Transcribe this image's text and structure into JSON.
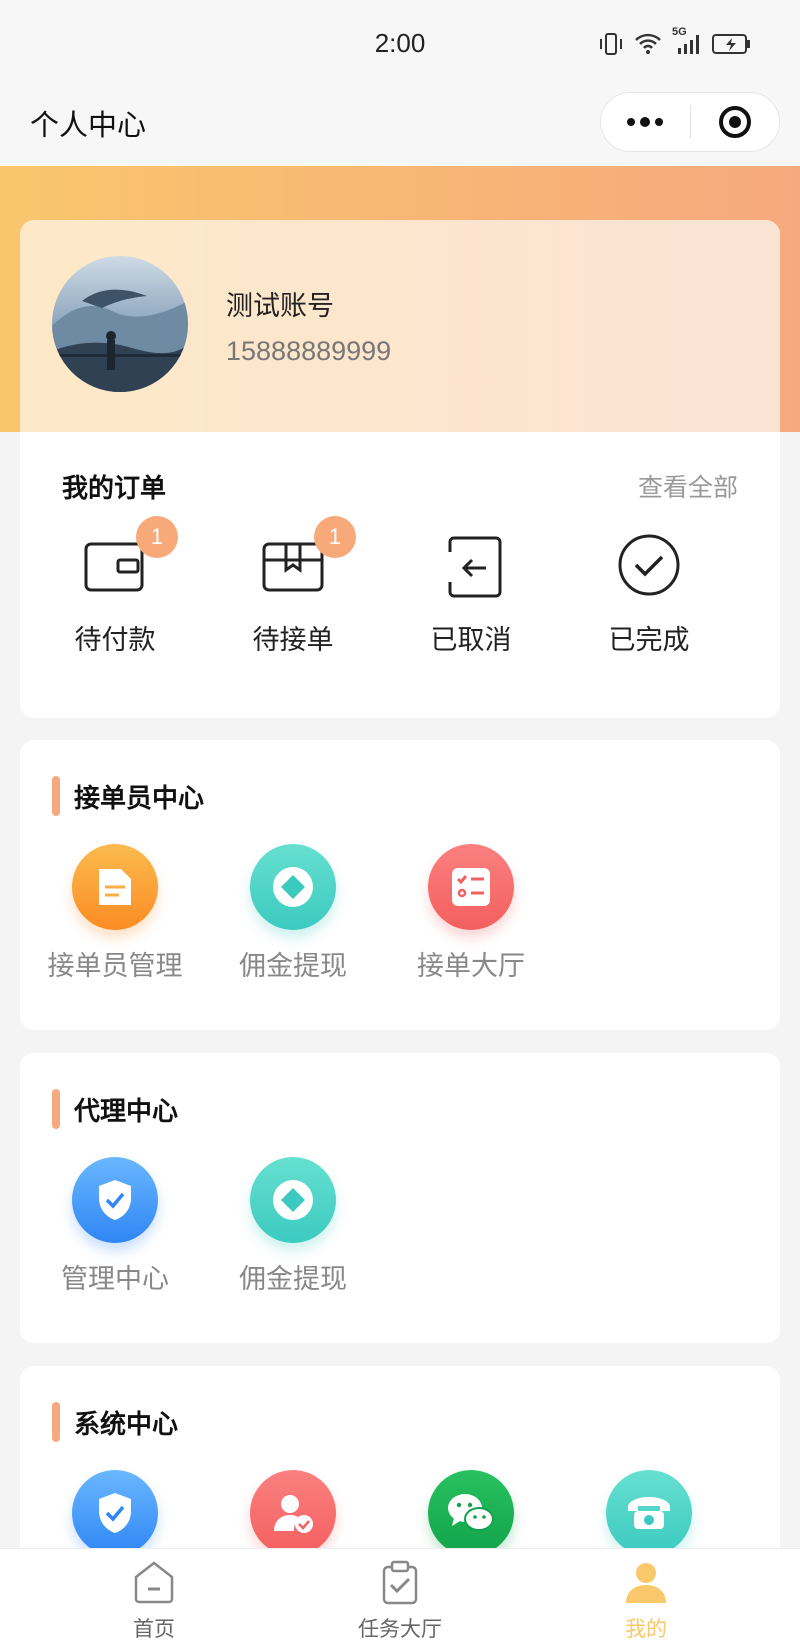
{
  "status_bar": {
    "time": "2:00",
    "network": "5G"
  },
  "navbar": {
    "title": "个人中心",
    "more_icon": "more-dots-icon",
    "target_icon": "target-icon"
  },
  "profile": {
    "name": "测试账号",
    "phone": "15888889999",
    "avatar": "avatar-photo"
  },
  "orders": {
    "title": "我的订单",
    "view_all": "查看全部",
    "items": [
      {
        "label": "待付款",
        "icon": "wallet-icon",
        "badge": "1"
      },
      {
        "label": "待接单",
        "icon": "package-icon",
        "badge": "1"
      },
      {
        "label": "已取消",
        "icon": "cancel-return-icon"
      },
      {
        "label": "已完成",
        "icon": "check-circle-icon"
      }
    ]
  },
  "picker_center": {
    "title": "接单员中心",
    "items": [
      {
        "label": "接单员管理",
        "icon": "document-icon",
        "color": "#fb8c23"
      },
      {
        "label": "佣金提现",
        "icon": "diamond-coin-icon",
        "color": "#3ccac0"
      },
      {
        "label": "接单大厅",
        "icon": "checklist-icon",
        "color": "#f45f5f"
      }
    ]
  },
  "agent_center": {
    "title": "代理中心",
    "items": [
      {
        "label": "管理中心",
        "icon": "shield-check-icon",
        "color": "#2f86f4"
      },
      {
        "label": "佣金提现",
        "icon": "diamond-coin-icon",
        "color": "#3ccac0"
      }
    ]
  },
  "system_center": {
    "title": "系统中心",
    "items": [
      {
        "icon": "shield-check-icon",
        "color": "#2f86f4"
      },
      {
        "icon": "user-verified-icon",
        "color": "#f45f5f"
      },
      {
        "icon": "wechat-icon",
        "color": "#12a34a"
      },
      {
        "icon": "telephone-icon",
        "color": "#3ccac0"
      }
    ]
  },
  "tabbar": {
    "tabs": [
      {
        "label": "首页",
        "icon": "home-icon",
        "active": false
      },
      {
        "label": "任务大厅",
        "icon": "task-clipboard-icon",
        "active": false
      },
      {
        "label": "我的",
        "icon": "person-icon",
        "active": true
      }
    ],
    "active_color": "#f9c86a"
  }
}
